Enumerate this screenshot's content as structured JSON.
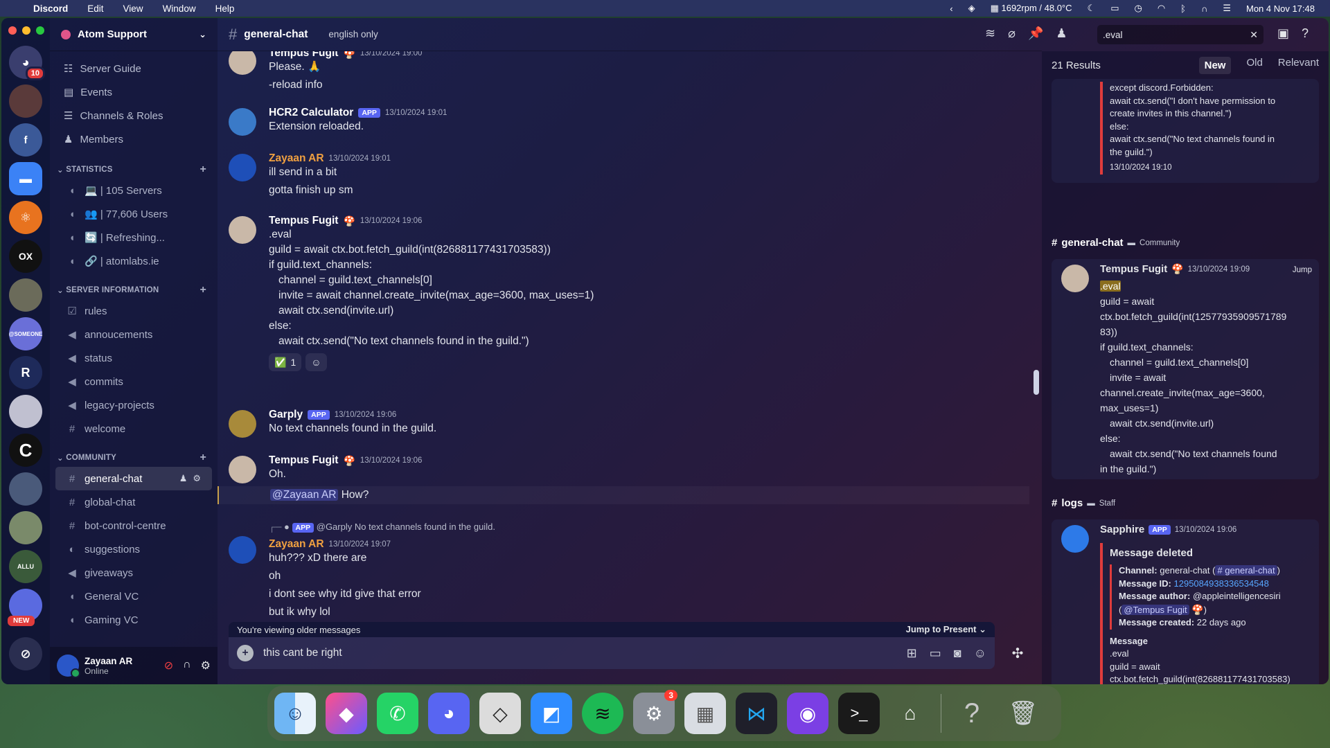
{
  "menubar": {
    "app": "Discord",
    "menus": [
      "Edit",
      "View",
      "Window",
      "Help"
    ],
    "status": "1692rpm / 48.0°C",
    "datetime": "Mon 4 Nov  17:48"
  },
  "rail": {
    "badge_count": "10",
    "new_label": "NEW"
  },
  "server": {
    "name": "Atom Support",
    "nav": [
      "Server Guide",
      "Events",
      "Channels & Roles",
      "Members"
    ],
    "categories": [
      {
        "name": "STATISTICS",
        "channels": [
          "💻 | 105 Servers",
          "👥 | 77,606 Users",
          "🔄 | Refreshing...",
          "🔗 | atomlabs.ie"
        ]
      },
      {
        "name": "SERVER INFORMATION",
        "channels": [
          "rules",
          "annoucements",
          "status",
          "commits",
          "legacy-projects",
          "welcome"
        ]
      },
      {
        "name": "COMMUNITY",
        "channels": [
          "general-chat",
          "global-chat",
          "bot-control-centre",
          "suggestions",
          "giveaways",
          "General VC",
          "Gaming VC"
        ]
      }
    ]
  },
  "user": {
    "name": "Zayaan AR",
    "status": "Online"
  },
  "channel": {
    "name": "general-chat",
    "topic": "english only"
  },
  "search": {
    "value": ".eval"
  },
  "messages": [
    {
      "author": "Tempus Fugit",
      "time": "13/10/2024 19:00",
      "lines": [
        "Please. 🙏",
        "-reload info"
      ]
    },
    {
      "author": "HCR2 Calculator",
      "app": "APP",
      "time": "13/10/2024 19:01",
      "lines": [
        "Extension reloaded."
      ]
    },
    {
      "author": "Zayaan AR",
      "time": "13/10/2024 19:01",
      "lines": [
        "ill send in a bit",
        "gotta finish up sm"
      ]
    },
    {
      "author": "Tempus Fugit",
      "time": "13/10/2024 19:06",
      "lines": [
        ".eval",
        "guild = await ctx.bot.fetch_guild(int(826881177431703583))",
        "if guild.text_channels:",
        "channel = guild.text_channels[0]",
        "invite = await channel.create_invite(max_age=3600, max_uses=1)",
        "await ctx.send(invite.url)",
        "else:",
        "await ctx.send(\"No text channels found in the guild.\")"
      ],
      "reaction": "✅",
      "reaction_count": "1"
    },
    {
      "author": "Garply",
      "app": "APP",
      "time": "13/10/2024 19:06",
      "lines": [
        "No text channels found in the guild."
      ]
    },
    {
      "author": "Tempus Fugit",
      "time": "13/10/2024 19:06",
      "lines": [
        "Oh."
      ],
      "mention": "@Zayaan AR",
      "after": "How?"
    },
    {
      "author": "Zayaan AR",
      "time": "13/10/2024 19:07",
      "reply": "@Garply No text channels found in the guild.",
      "reply_app": "APP",
      "lines": [
        "huh??? xD there are",
        "oh",
        "i dont see why itd give that error",
        "but ik why lol"
      ]
    }
  ],
  "composer": {
    "older_notice": "You're viewing older messages",
    "jump": "Jump to Present",
    "text": "this cant be right"
  },
  "results": {
    "count": "21 Results",
    "tabs": [
      "New",
      "Old",
      "Relevant"
    ],
    "card1_lines": [
      "except discord.Forbidden:",
      "await ctx.send(\"I don't have permission to",
      "create invites in this channel.\")",
      "else:",
      "await ctx.send(\"No text channels found in",
      "the guild.\")"
    ],
    "card1_time": "13/10/2024 19:10",
    "card2_channel": "general-chat",
    "card2_category": "Community",
    "card2_author": "Tempus Fugit",
    "card2_time": "13/10/2024 19:09",
    "card2_jump": "Jump",
    "card2_mark": ".eval",
    "card2_lines": [
      "guild = await",
      "ctx.bot.fetch_guild(int(12577935909571789",
      "83))",
      "if guild.text_channels:",
      "channel = guild.text_channels[0]",
      "invite = await",
      "channel.create_invite(max_age=3600,",
      "max_uses=1)",
      "await ctx.send(invite.url)",
      "else:",
      "await ctx.send(\"No text channels found",
      "in the guild.\")"
    ],
    "card3_channel": "logs",
    "card3_category": "Staff",
    "card3_author": "Sapphire",
    "card3_app": "APP",
    "card3_time": "13/10/2024 19:06",
    "embed_title": "Message deleted",
    "embed_channel_label": "Channel:",
    "embed_channel_value": "general-chat (",
    "embed_channel_link": "# general-chat",
    "embed_id_label": "Message ID:",
    "embed_id": "1295084938336534548",
    "embed_author_label": "Message author:",
    "embed_author": "@appleintelligencesiri",
    "embed_author_mention": "@Tempus Fugit",
    "embed_created_label": "Message created:",
    "embed_created": "22 days ago",
    "embed_msg_label": "Message",
    "embed_msg_lines": [
      ".eval",
      "guild = await",
      "ctx.bot.fetch_guild(int(826881177431703583)"
    ]
  },
  "dock": {
    "apps": [
      "Finder",
      "Shortcuts",
      "WhatsApp",
      "Discord",
      "Roblox",
      "Roblox Studio",
      "Spotify",
      "System Settings",
      "Launchpad",
      "Visual Studio Code",
      "GitHub Desktop",
      "Terminal",
      "Unity Hub",
      "Help",
      "Trash"
    ],
    "settings_badge": "3"
  }
}
